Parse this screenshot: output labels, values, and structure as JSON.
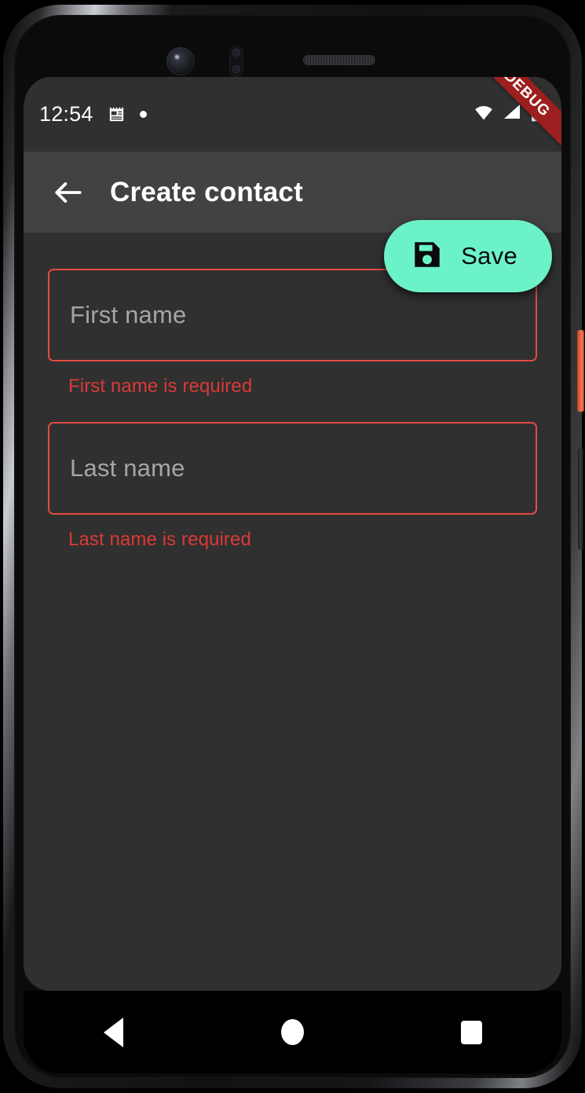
{
  "device": {
    "hardware": {
      "power_button": "power-button",
      "volume_button": "volume-rocker",
      "front_camera": "front-camera",
      "proximity_sensor": "proximity-sensor",
      "earpiece_speaker": "earpiece-speaker"
    }
  },
  "status_bar": {
    "clock": "12:54",
    "icons": {
      "calendar": "calendar-icon",
      "notification_dot": "notification-dot-icon",
      "wifi": "wifi-icon",
      "cellular": "cellular-signal-icon",
      "battery": "battery-icon"
    },
    "debug_banner": "DEBUG",
    "debug_banner_color": "#9c1f1f",
    "background_color": "#303030"
  },
  "app_bar": {
    "back_icon": "back-arrow-icon",
    "title": "Create contact",
    "background_color": "#424242",
    "title_color": "#ffffff"
  },
  "fab": {
    "label": "Save",
    "icon": "save-floppy-disk-icon",
    "background_color": "#6cf2c9",
    "text_color": "#0a0a0a"
  },
  "form": {
    "error_color": "#d93a36",
    "border_color": "#e44b42",
    "placeholder_color": "#a5a5a5",
    "fields": [
      {
        "name": "first-name",
        "placeholder": "First name",
        "value": "",
        "error": "First name is required"
      },
      {
        "name": "last-name",
        "placeholder": "Last name",
        "value": "",
        "error": "Last name is required"
      }
    ]
  },
  "nav_bar": {
    "background_color": "#000000",
    "buttons": [
      {
        "name": "nav-back",
        "icon": "triangle-back-icon"
      },
      {
        "name": "nav-home",
        "icon": "circle-home-icon"
      },
      {
        "name": "nav-recents",
        "icon": "square-recents-icon"
      }
    ]
  },
  "body": {
    "background_color": "#303030"
  }
}
